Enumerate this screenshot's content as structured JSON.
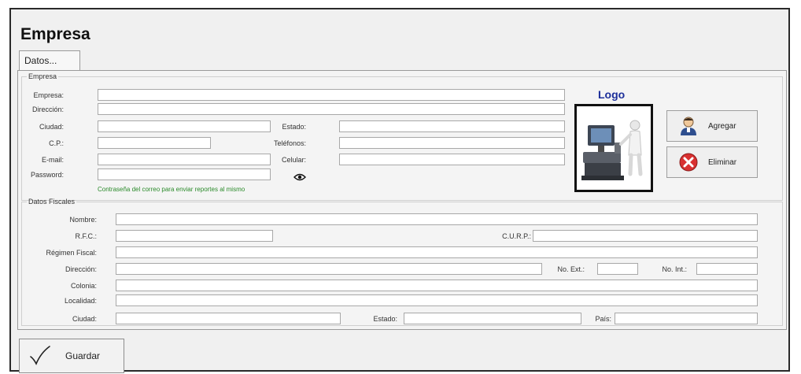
{
  "window": {
    "title": "Empresa"
  },
  "tabs": [
    {
      "label": "Datos..."
    }
  ],
  "empresa_group": {
    "legend": "Empresa",
    "labels": {
      "empresa": "Empresa:",
      "direccion": "Dirección:",
      "ciudad": "Ciudad:",
      "cp": "C.P.:",
      "email": "E-mail:",
      "password": "Password:",
      "estado": "Estado:",
      "telefonos": "Teléfonos:",
      "celular": "Celular:"
    },
    "values": {
      "empresa": "",
      "direccion": "",
      "ciudad": "",
      "cp": "",
      "email": "",
      "password": "",
      "estado": "",
      "telefonos": "",
      "celular": ""
    },
    "password_hint": "Contraseña del correo para enviar reportes al mismo"
  },
  "logo": {
    "label": "Logo",
    "icon": "pos-terminal-illustration"
  },
  "logo_buttons": {
    "add": "Agregar",
    "delete": "Eliminar"
  },
  "fiscal_group": {
    "legend": "Datos Fiscales",
    "labels": {
      "nombre": "Nombre:",
      "rfc": "R.F.C.:",
      "curp": "C.U.R.P.:",
      "regimen": "Régimen Fiscal:",
      "direccion": "Dirección:",
      "no_ext": "No. Ext.:",
      "no_int": "No. Int.:",
      "colonia": "Colonia:",
      "localidad": "Localidad:",
      "ciudad": "Ciudad:",
      "estado": "Estado:",
      "pais": "País:"
    },
    "values": {
      "nombre": "",
      "rfc": "",
      "curp": "",
      "regimen": "",
      "direccion": "",
      "no_ext": "",
      "no_int": "",
      "colonia": "",
      "localidad": "",
      "ciudad": "",
      "estado": "",
      "pais": ""
    }
  },
  "footer": {
    "save": "Guardar"
  },
  "colors": {
    "logo_title": "#1d2f9a",
    "hint": "#2a8a2a",
    "delete_icon": "#d83030"
  }
}
